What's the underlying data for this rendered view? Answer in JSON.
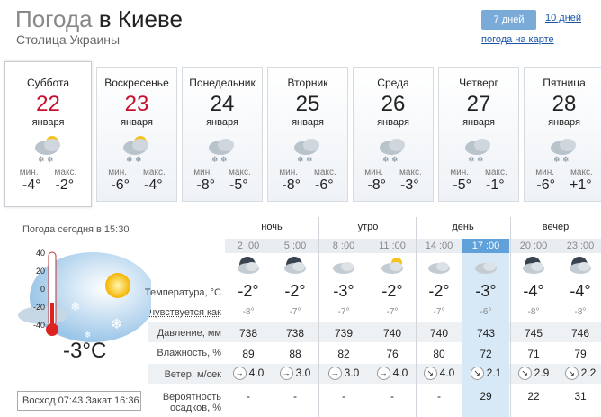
{
  "header": {
    "title_gray": "Погода",
    "title_dark": "в Киеве",
    "subtitle": "Столица Украины",
    "btn_7": "7 дней",
    "link_10": "10 дней",
    "map_link": "погода на карте"
  },
  "days": [
    {
      "name": "Суббота",
      "num": "22",
      "month": "января",
      "min_l": "мин.",
      "max_l": "макс.",
      "min": "-4°",
      "max": "-2°",
      "red": true,
      "icon": "sun-snow-icon"
    },
    {
      "name": "Воскресенье",
      "num": "23",
      "month": "января",
      "min_l": "мин.",
      "max_l": "макс.",
      "min": "-6°",
      "max": "-4°",
      "red": true,
      "icon": "sun-snow-icon"
    },
    {
      "name": "Понедельник",
      "num": "24",
      "month": "января",
      "min_l": "мин.",
      "max_l": "макс.",
      "min": "-8°",
      "max": "-5°",
      "red": false,
      "icon": "cloud-snow-icon"
    },
    {
      "name": "Вторник",
      "num": "25",
      "month": "января",
      "min_l": "мин.",
      "max_l": "макс.",
      "min": "-8°",
      "max": "-6°",
      "red": false,
      "icon": "cloud-snow-icon"
    },
    {
      "name": "Среда",
      "num": "26",
      "month": "января",
      "min_l": "мин.",
      "max_l": "макс.",
      "min": "-8°",
      "max": "-3°",
      "red": false,
      "icon": "cloud-snow-icon"
    },
    {
      "name": "Четверг",
      "num": "27",
      "month": "января",
      "min_l": "мин.",
      "max_l": "макс.",
      "min": "-5°",
      "max": "-1°",
      "red": false,
      "icon": "cloud-snow-icon"
    },
    {
      "name": "Пятница",
      "num": "28",
      "month": "января",
      "min_l": "мин.",
      "max_l": "макс.",
      "min": "-6°",
      "max": "+1°",
      "red": false,
      "icon": "cloud-snow-icon"
    }
  ],
  "now": {
    "label": "Погода сегодня в 15:30",
    "temp": "-3°C",
    "thermo_ticks": [
      "40",
      "20",
      "0",
      "-20",
      "-40"
    ],
    "sunrise": "Восход 07:43 Закат 16:36"
  },
  "periods": [
    "ночь",
    "утро",
    "день",
    "вечер"
  ],
  "times": [
    "2 :00",
    "5 :00",
    "8 :00",
    "11 :00",
    "14 :00",
    "17 :00",
    "20 :00",
    "23 :00"
  ],
  "labels": {
    "temp": "Температура, °C",
    "feel": "чувствуется как",
    "pressure": "Давление, мм",
    "humidity": "Влажность, %",
    "wind": "Ветер, м/сек",
    "precip1": "Вероятность",
    "precip2": "осадков, %"
  },
  "temps": [
    "-2°",
    "-2°",
    "-3°",
    "-2°",
    "-2°",
    "-3°",
    "-4°",
    "-4°"
  ],
  "feels": [
    "-8°",
    "-7°",
    "-7°",
    "-7°",
    "-7°",
    "-6°",
    "-8°",
    "-8°"
  ],
  "pressure": [
    "738",
    "738",
    "739",
    "740",
    "740",
    "743",
    "745",
    "746"
  ],
  "humidity": [
    "89",
    "88",
    "82",
    "76",
    "80",
    "72",
    "71",
    "79"
  ],
  "wind": [
    "4.0",
    "3.0",
    "3.0",
    "4.0",
    "4.0",
    "2.1",
    "2.9",
    "2.2"
  ],
  "wind_dirs": [
    "→",
    "→",
    "→",
    "→",
    "↘",
    "↘",
    "↘",
    "↘"
  ],
  "precip": [
    "-",
    "-",
    "-",
    "-",
    "-",
    "29",
    "22",
    "31"
  ],
  "colors": {
    "accent": "#5fa1d8",
    "red": "#c8102e",
    "link": "#1a55a8"
  }
}
